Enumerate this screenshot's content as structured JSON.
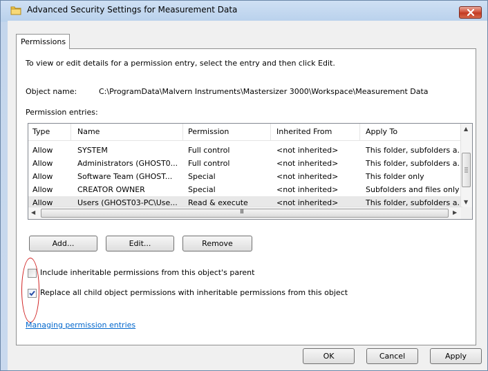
{
  "window": {
    "title": "Advanced Security Settings for Measurement Data",
    "close_icon": "close-icon",
    "title_icon": "folder-icon"
  },
  "tabs": [
    {
      "label": "Permissions",
      "active": true
    }
  ],
  "permissions": {
    "description": "To view or edit details for a permission entry, select the entry and then click Edit.",
    "object_name_label": "Object name:",
    "object_name_value": "C:\\ProgramData\\Malvern Instruments\\Mastersizer 3000\\Workspace\\Measurement Data",
    "entries_label": "Permission entries:",
    "columns": [
      "Type",
      "Name",
      "Permission",
      "Inherited From",
      "Apply To"
    ],
    "rows": [
      [
        "Allow",
        "SYSTEM",
        "Full control",
        "<not inherited>",
        "This folder, subfolders a..."
      ],
      [
        "Allow",
        "Administrators (GHOST0...",
        "Full control",
        "<not inherited>",
        "This folder, subfolders a..."
      ],
      [
        "Allow",
        "Software Team (GHOST...",
        "Special",
        "<not inherited>",
        "This folder only"
      ],
      [
        "Allow",
        "CREATOR OWNER",
        "Special",
        "<not inherited>",
        "Subfolders and files only"
      ],
      [
        "Allow",
        "Users (GHOST03-PC\\Use...",
        "Read & execute",
        "<not inherited>",
        "This folder, subfolders a..."
      ]
    ],
    "selected_row": 4,
    "scroll_mid_glyph": "III",
    "buttons": {
      "add": "Add...",
      "edit": "Edit...",
      "remove": "Remove"
    },
    "checkboxes": [
      {
        "label": "Include inheritable permissions from this object's parent",
        "checked": false
      },
      {
        "label": "Replace all child object permissions with inheritable permissions from this object",
        "checked": true
      }
    ],
    "link": "Managing permission entries"
  },
  "footer": {
    "ok": "OK",
    "cancel": "Cancel",
    "apply": "Apply"
  },
  "colors": {
    "accent": "#0066cc",
    "selection": "#e8e8e8",
    "annotation": "#d02020",
    "check": "#2a4fa8"
  }
}
